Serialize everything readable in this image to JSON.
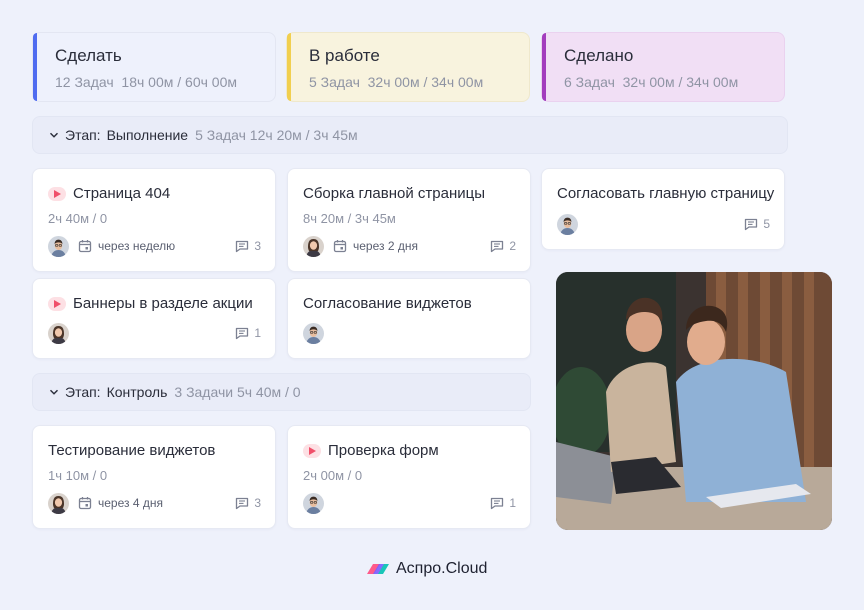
{
  "columns": [
    {
      "title": "Сделать",
      "stats": "12 Задач  18ч 00м / 60ч 00м",
      "accent": "#4f6cf0"
    },
    {
      "title": "В работе",
      "stats": "5 Задач  32ч 00м / 34ч 00м",
      "accent": "#f1cf4f"
    },
    {
      "title": "Сделано",
      "stats": "6 Задач  32ч 00м / 34ч 00м",
      "accent": "#a33dbd"
    }
  ],
  "stages": [
    {
      "label": "Этап:",
      "name": "Выполнение",
      "meta": "5 Задач 12ч 20м / 3ч 45м"
    },
    {
      "label": "Этап:",
      "name": "Контроль",
      "meta": "3 Задачи 5ч 40м / 0"
    }
  ],
  "cards": [
    {
      "title": "Страница 404",
      "time": "2ч 40м / 0",
      "due": "через неделю",
      "comments": "3",
      "priority": true
    },
    {
      "title": "Сборка главной страницы",
      "time": "8ч 20м / 3ч 45м",
      "due": "через 2 дня",
      "comments": "2",
      "priority": false
    },
    {
      "title": "Согласовать главную страницу",
      "comments": "5",
      "priority": false
    },
    {
      "title": "Баннеры в разделе акции",
      "comments": "1",
      "priority": true
    },
    {
      "title": "Согласование виджетов",
      "priority": false
    },
    {
      "title": "Тестирование виджетов",
      "time": "1ч 10м / 0",
      "due": "через 4 дня",
      "comments": "3",
      "priority": false
    },
    {
      "title": "Проверка форм",
      "time": "2ч 00м / 0",
      "comments": "1",
      "priority": true
    }
  ],
  "brand": {
    "name": "Аспро.Cloud"
  },
  "colors": {
    "priority": "#f0506a",
    "background": "#eef1fb"
  }
}
